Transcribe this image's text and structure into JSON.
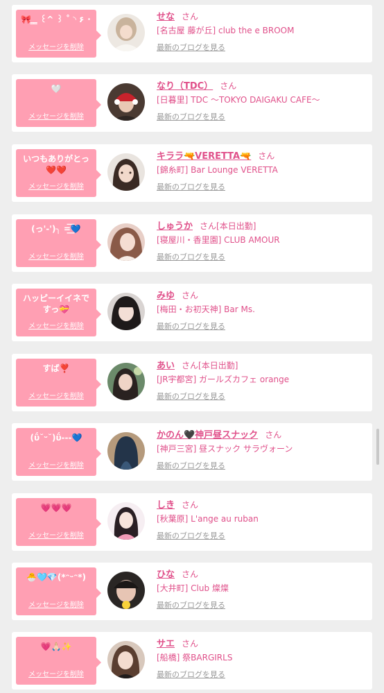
{
  "delete_label": "メッセージを削除",
  "blog_label": "最新のブログを見る",
  "honorific": "さん",
  "colors": {
    "background": "#eeeeee",
    "card": "#ffffff",
    "bubble": "#ff9fb3",
    "accent": "#e0508a",
    "link_gray": "#999999"
  },
  "items": [
    {
      "message": "🎀 ̳  ̳ ꒰^ ꒱ ˚ ◝ ۶ ･",
      "name": "せな",
      "status": "",
      "shop": "[名古屋 藤が丘] club the e BROOM",
      "avatar_icon": "avatar-photo"
    },
    {
      "message": "🤍",
      "name": "なり（TDC）",
      "status": "",
      "shop": "[日暮里] TDC 〜TOKYO DAIGAKU CAFE〜",
      "avatar_icon": "avatar-photo"
    },
    {
      "message": "いつもありがとっ❤️❤️",
      "name": "キララ🔫VERETTA🔫",
      "status": "",
      "shop": "[錦糸町] Bar Lounge VERETTA",
      "avatar_icon": "avatar-photo"
    },
    {
      "message": "(っ'-')╮ =͟͟͞͞💙",
      "name": "しゅうか",
      "status": "[本日出勤]",
      "shop": "[寝屋川・香里園] CLUB AMOUR",
      "avatar_icon": "avatar-photo"
    },
    {
      "message": "ハッピーイイネですっ💝",
      "name": "みゆ",
      "status": "",
      "shop": "[梅田・お初天神] Bar Ms.",
      "avatar_icon": "avatar-photo"
    },
    {
      "message": "すば❣️",
      "name": "あい",
      "status": "[本日出勤]",
      "shop": "[JR宇都宮] ガールズカフェ orange",
      "avatar_icon": "avatar-photo"
    },
    {
      "message": "(ΰ˘ᵕ˘)ΰ---💙",
      "name": "かのん🖤神戸昼スナック",
      "status": "",
      "shop": "[神戸三宮] 昼スナック サラヴォーン",
      "avatar_icon": "avatar-photo"
    },
    {
      "message": "💗💗💗",
      "name": "しき",
      "status": "",
      "shop": "[秋葉原] L'ange au ruban",
      "avatar_icon": "avatar-photo"
    },
    {
      "message": "🐣🩵💎(*ᵔᵕᵔ*)",
      "name": "ひな",
      "status": "",
      "shop": "[大井町] Club 燦燦",
      "avatar_icon": "avatar-photo"
    },
    {
      "message": "💗🙏🏻✨",
      "name": "サエ",
      "status": "",
      "shop": "[船橋] 祭BARGIRLS",
      "avatar_icon": "avatar-photo"
    }
  ]
}
